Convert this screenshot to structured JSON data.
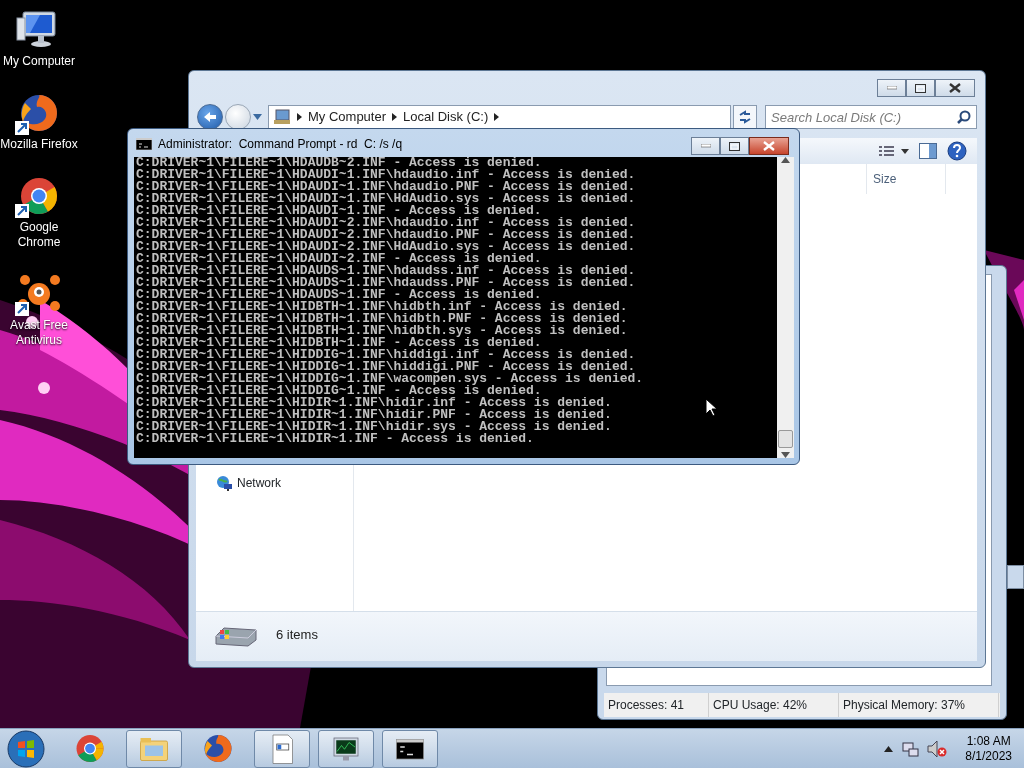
{
  "desktop_icons": [
    {
      "kind": "computer",
      "label": "My Computer"
    },
    {
      "kind": "firefox",
      "label": "Mozilla Firefox"
    },
    {
      "kind": "chrome",
      "label": "Google Chrome"
    },
    {
      "kind": "avast",
      "label": "Avast Free Antivirus"
    }
  ],
  "task_manager": {
    "status": [
      "Processes: 41",
      "CPU Usage: 42%",
      "Physical Memory: 37%"
    ]
  },
  "explorer": {
    "active": false,
    "breadcrumb": [
      "My Computer",
      "Local Disk (C:)"
    ],
    "search": {
      "placeholder": "Search Local Disk (C:)"
    },
    "columns": [
      "Size"
    ],
    "nav_items": [
      "Network"
    ],
    "status": "6 items"
  },
  "cmd": {
    "active": true,
    "title": "Administrator:  Command Prompt - rd  C: /s /q",
    "lines": [
      "C:DRIVER~1\\FILERE~1\\HDAUDB~2.INF - Access is denied.",
      "C:DRIVER~1\\FILERE~1\\HDAUDI~1.INF\\hdaudio.inf - Access is denied.",
      "C:DRIVER~1\\FILERE~1\\HDAUDI~1.INF\\hdaudio.PNF - Access is denied.",
      "C:DRIVER~1\\FILERE~1\\HDAUDI~1.INF\\HdAudio.sys - Access is denied.",
      "C:DRIVER~1\\FILERE~1\\HDAUDI~1.INF - Access is denied.",
      "C:DRIVER~1\\FILERE~1\\HDAUDI~2.INF\\hdaudio.inf - Access is denied.",
      "C:DRIVER~1\\FILERE~1\\HDAUDI~2.INF\\hdaudio.PNF - Access is denied.",
      "C:DRIVER~1\\FILERE~1\\HDAUDI~2.INF\\HdAudio.sys - Access is denied.",
      "C:DRIVER~1\\FILERE~1\\HDAUDI~2.INF - Access is denied.",
      "C:DRIVER~1\\FILERE~1\\HDAUDS~1.INF\\hdaudss.inf - Access is denied.",
      "C:DRIVER~1\\FILERE~1\\HDAUDS~1.INF\\hdaudss.PNF - Access is denied.",
      "C:DRIVER~1\\FILERE~1\\HDAUDS~1.INF - Access is denied.",
      "C:DRIVER~1\\FILERE~1\\HIDBTH~1.INF\\hidbth.inf - Access is denied.",
      "C:DRIVER~1\\FILERE~1\\HIDBTH~1.INF\\hidbth.PNF - Access is denied.",
      "C:DRIVER~1\\FILERE~1\\HIDBTH~1.INF\\hidbth.sys - Access is denied.",
      "C:DRIVER~1\\FILERE~1\\HIDBTH~1.INF - Access is denied.",
      "C:DRIVER~1\\FILERE~1\\HIDDIG~1.INF\\hiddigi.inf - Access is denied.",
      "C:DRIVER~1\\FILERE~1\\HIDDIG~1.INF\\hiddigi.PNF - Access is denied.",
      "C:DRIVER~1\\FILERE~1\\HIDDIG~1.INF\\wacompen.sys - Access is denied.",
      "C:DRIVER~1\\FILERE~1\\HIDDIG~1.INF - Access is denied.",
      "C:DRIVER~1\\FILERE~1\\HIDIR~1.INF\\hidir.inf - Access is denied.",
      "C:DRIVER~1\\FILERE~1\\HIDIR~1.INF\\hidir.PNF - Access is denied.",
      "C:DRIVER~1\\FILERE~1\\HIDIR~1.INF\\hidir.sys - Access is denied.",
      "C:DRIVER~1\\FILERE~1\\HIDIR~1.INF - Access is denied."
    ]
  },
  "taskbar": {
    "apps": [
      {
        "kind": "chrome",
        "running": false
      },
      {
        "kind": "folder",
        "running": true
      },
      {
        "kind": "firefox",
        "running": false
      },
      {
        "kind": "document",
        "running": true
      },
      {
        "kind": "monitor",
        "running": true
      },
      {
        "kind": "console",
        "running": true
      }
    ],
    "time": "1:08 AM",
    "date": "8/1/2023"
  }
}
